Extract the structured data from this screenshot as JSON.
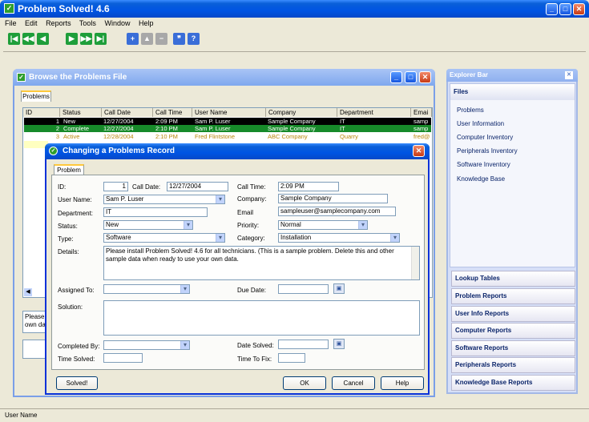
{
  "app": {
    "title": "Problem Solved! 4.6"
  },
  "menu": [
    "File",
    "Edit",
    "Reports",
    "Tools",
    "Window",
    "Help"
  ],
  "browse": {
    "title": "Browse the Problems File",
    "tab": "Problems",
    "columns": [
      "ID",
      "Status",
      "Call Date",
      "Call Time",
      "User Name",
      "Company",
      "Department",
      "Emai"
    ],
    "rows": [
      [
        "1",
        "New",
        "12/27/2004",
        "2:09 PM",
        "Sam P. Luser",
        "Sample Company",
        "IT",
        "samp"
      ],
      [
        "2",
        "Complete",
        "12/27/2004",
        "2:10 PM",
        "Sam P. Luser",
        "Sample Company",
        "IT",
        "samp"
      ],
      [
        "3",
        "Active",
        "12/28/2004",
        "2:10 PM",
        "Fred Flintstone",
        "ABC Company",
        "Quarry",
        "fred@"
      ]
    ],
    "note": "Please i own dat"
  },
  "dialog": {
    "title": "Changing a Problems Record",
    "tab": "Problem",
    "labels": {
      "id": "ID:",
      "call_date": "Call Date:",
      "call_time": "Call Time:",
      "user_name": "User Name:",
      "company": "Company:",
      "department": "Department:",
      "email": "Email",
      "status": "Status:",
      "priority": "Priority:",
      "type": "Type:",
      "category": "Category:",
      "details": "Details:",
      "assigned_to": "Assigned To:",
      "due_date": "Due Date:",
      "solution": "Solution:",
      "completed_by": "Completed By:",
      "date_solved": "Date Solved:",
      "time_solved": "Time Solved:",
      "time_to_fix": "Time To Fix:"
    },
    "values": {
      "id": "1",
      "call_date": "12/27/2004",
      "call_time": "2:09 PM",
      "user_name": "Sam P. Luser",
      "company": "Sample Company",
      "department": "IT",
      "email": "sampleuser@samplecompany.com",
      "status": "New",
      "priority": "Normal",
      "type": "Software",
      "category": "Installation",
      "details": "Please install Problem Solved! 4.6 for all technicians.  (This is a sample problem.  Delete this and other sample data when ready to use your own data.",
      "assigned_to": "",
      "due_date": "",
      "solution": "",
      "completed_by": "",
      "date_solved": "",
      "time_solved": "",
      "time_to_fix": ""
    },
    "buttons": {
      "solved": "Solved!",
      "ok": "OK",
      "cancel": "Cancel",
      "help": "Help"
    }
  },
  "explorer": {
    "title": "Explorer Bar",
    "files_header": "Files",
    "files": [
      "Problems",
      "User Information",
      "Computer Inventory",
      "Peripherals Inventory",
      "Software Inventory",
      "Knowledge Base"
    ],
    "sections": [
      "Lookup Tables",
      "Problem Reports",
      "User Info Reports",
      "Computer Reports",
      "Software Reports",
      "Peripherals Reports",
      "Knowledge Base Reports"
    ]
  },
  "status": {
    "text": "User Name"
  }
}
